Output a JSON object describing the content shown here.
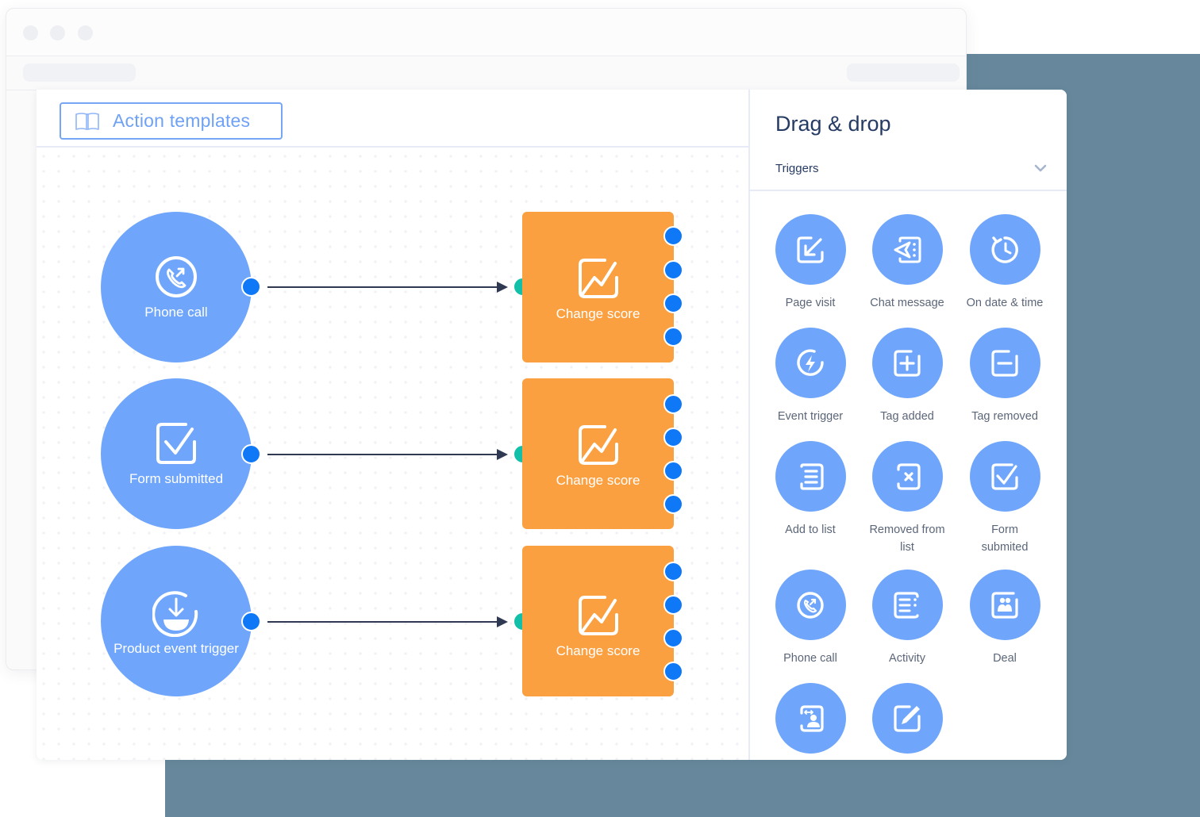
{
  "colors": {
    "backdrop": "#67889c",
    "trigger": "#6fa6fb",
    "action": "#fba040",
    "port_out": "#0f78f6",
    "port_in": "#12bfa8",
    "accent_border": "#76a6f6",
    "title_text": "#263b63"
  },
  "toolbar": {
    "templates_icon": "book-open-icon",
    "templates_label": "Action templates"
  },
  "canvas": {
    "triggers": [
      {
        "label": "Phone call",
        "icon": "phone-call-icon"
      },
      {
        "label": "Form submitted",
        "icon": "checkbox-icon"
      },
      {
        "label": "Product event trigger",
        "icon": "product-event-icon"
      }
    ],
    "actions": [
      {
        "label": "Change score",
        "icon": "score-chart-icon"
      },
      {
        "label": "Change score",
        "icon": "score-chart-icon"
      },
      {
        "label": "Change score",
        "icon": "score-chart-icon"
      }
    ]
  },
  "sidebar": {
    "title": "Drag & drop",
    "section": {
      "selected": "Triggers",
      "icon": "chevron-down-icon"
    },
    "items": [
      {
        "label": "Page visit",
        "icon": "page-visit-icon"
      },
      {
        "label": "Chat message",
        "icon": "chat-message-icon"
      },
      {
        "label": "On date & time",
        "icon": "date-time-icon"
      },
      {
        "label": "Event trigger",
        "icon": "event-trigger-icon"
      },
      {
        "label": "Tag added",
        "icon": "tag-added-icon"
      },
      {
        "label": "Tag removed",
        "icon": "tag-removed-icon"
      },
      {
        "label": "Add to list",
        "icon": "add-to-list-icon"
      },
      {
        "label": "Removed from list",
        "icon": "removed-from-list-icon"
      },
      {
        "label": "Form submited",
        "icon": "form-submitted-icon"
      },
      {
        "label": "Phone call",
        "icon": "phone-call-icon"
      },
      {
        "label": "Activity",
        "icon": "activity-icon"
      },
      {
        "label": "Deal",
        "icon": "deal-icon"
      },
      {
        "label": "",
        "icon": "contact-field-icon"
      },
      {
        "label": "",
        "icon": "edit-icon"
      }
    ]
  }
}
